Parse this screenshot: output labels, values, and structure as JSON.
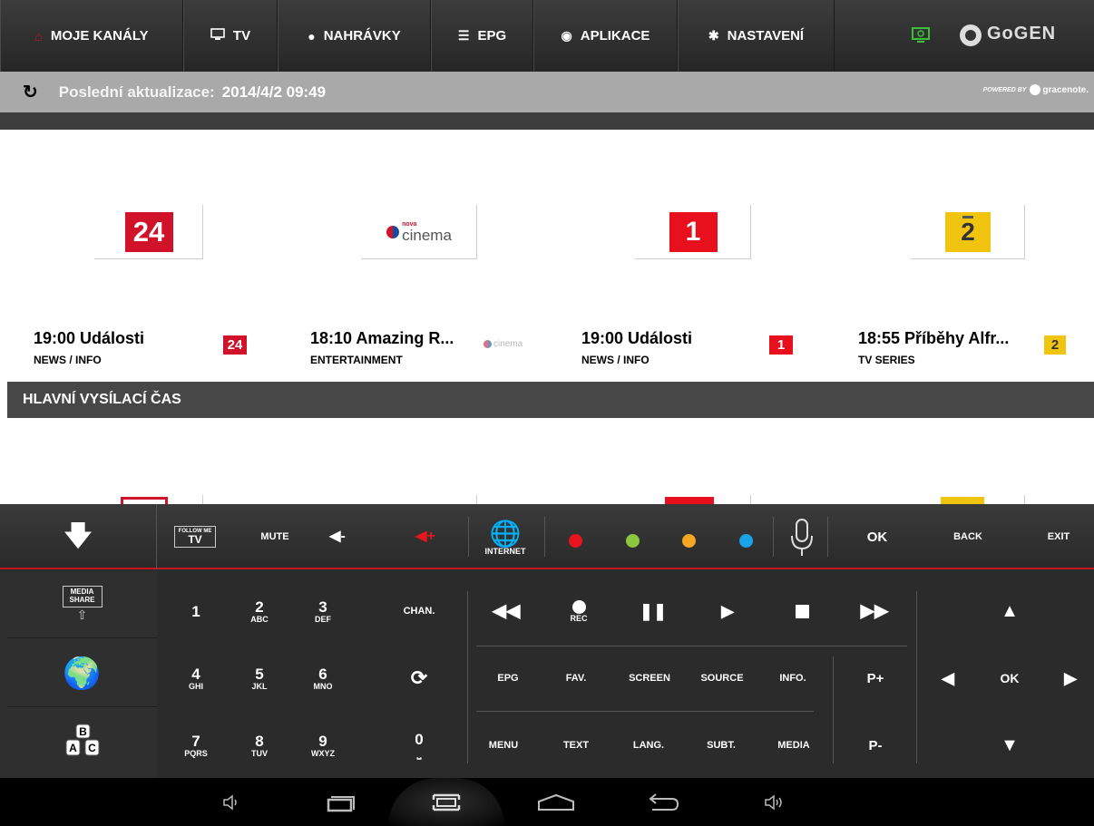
{
  "topnav": {
    "tabs": [
      {
        "label": "MOJE KANÁLY",
        "icon": "house-icon"
      },
      {
        "label": "TV",
        "icon": "tv-icon"
      },
      {
        "label": "NAHRÁVKY",
        "icon": "dot-icon"
      },
      {
        "label": "EPG",
        "icon": "list-icon"
      },
      {
        "label": "APLIKACE",
        "icon": "apps-icon"
      },
      {
        "label": "NASTAVENÍ",
        "icon": "gear-icon"
      }
    ],
    "brand": "GoGEN"
  },
  "update": {
    "label": "Poslední aktualizace:",
    "value": "2014/4/2 09:49",
    "powered": "POWERED BY",
    "provider": "gracenote."
  },
  "channels": [
    {
      "logo": "24",
      "program_time": "19:00 Události",
      "genre": "NEWS / INFO"
    },
    {
      "logo": "nova cinema",
      "logo_small": "nova",
      "logo_big": "cinema",
      "program_time": "18:10 Amazing R...",
      "genre": "ENTERTAINMENT"
    },
    {
      "logo": "1",
      "program_time": "19:00 Události",
      "genre": "NEWS / INFO"
    },
    {
      "logo": "2",
      "program_time": "18:55 Příběhy Alfr...",
      "genre": "TV SERIES"
    }
  ],
  "section": {
    "title": "HLAVNÍ VYSÍLACÍ ČAS"
  },
  "remote": {
    "top": {
      "follow_top": "FOLLOW ME",
      "follow_tv": "TV",
      "mute": "MUTE",
      "vol_down": "◀-",
      "vol_up": "◀+",
      "internet": "INTERNET",
      "ok": "OK",
      "back": "BACK",
      "exit": "EXIT",
      "colors": {
        "red": "#e8141e",
        "green": "#8cc63f",
        "yellow": "#f5a623",
        "blue": "#1aa3e8"
      }
    },
    "left": {
      "media_share": "MEDIA SHARE"
    },
    "numpad": [
      {
        "d": "1",
        "s": ""
      },
      {
        "d": "2",
        "s": "ABC"
      },
      {
        "d": "3",
        "s": "DEF"
      },
      {
        "d": "CHAN.",
        "s": ""
      },
      {
        "d": "4",
        "s": "GHI"
      },
      {
        "d": "5",
        "s": "JKL"
      },
      {
        "d": "6",
        "s": "MNO"
      },
      {
        "d": "⟳",
        "s": ""
      },
      {
        "d": "7",
        "s": "PQRS"
      },
      {
        "d": "8",
        "s": "TUV"
      },
      {
        "d": "9",
        "s": "WXYZ"
      },
      {
        "d": "0",
        "s": "⎵"
      }
    ],
    "media": {
      "rec": "REC",
      "row2": [
        "EPG",
        "FAV.",
        "SCREEN",
        "SOURCE",
        "INFO."
      ],
      "row3": [
        "MENU",
        "TEXT",
        "LANG.",
        "SUBT.",
        "MEDIA"
      ],
      "p_plus": "P+",
      "p_minus": "P-"
    },
    "dpad": {
      "ok": "OK"
    }
  }
}
